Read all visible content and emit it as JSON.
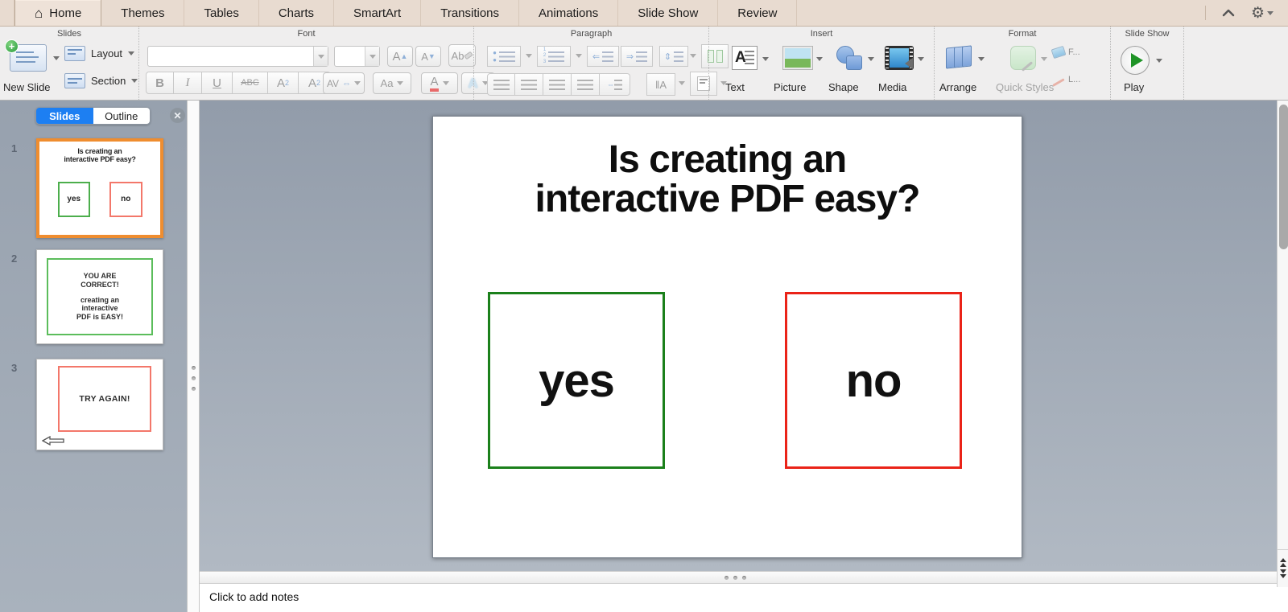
{
  "tabbar": {
    "tabs": [
      "Home",
      "Themes",
      "Tables",
      "Charts",
      "SmartArt",
      "Transitions",
      "Animations",
      "Slide Show",
      "Review"
    ],
    "active_tab": "Home"
  },
  "ribbon": {
    "slides": {
      "label": "Slides",
      "new_slide": "New Slide",
      "layout": "Layout",
      "section": "Section"
    },
    "font": {
      "label": "Font",
      "bold": "B",
      "italic": "I",
      "underline": "U",
      "strike": "ABC",
      "superscript_base": "A",
      "superscript_mark": "2",
      "subscript_base": "A",
      "subscript_mark": "2",
      "spacing": "AV",
      "change_case": "Aa",
      "font_color": "A",
      "text_effects": "A",
      "clear_formatting": "Ab"
    },
    "paragraph": {
      "label": "Paragraph"
    },
    "insert": {
      "label": "Insert",
      "text": "Text",
      "picture": "Picture",
      "shape": "Shape",
      "media": "Media"
    },
    "format": {
      "label": "Format",
      "arrange": "Arrange",
      "quick_styles": "Quick Styles",
      "fill": "F...",
      "line": "L..."
    },
    "slideshow": {
      "label": "Slide Show",
      "play": "Play"
    }
  },
  "sidebar": {
    "tabs": {
      "slides": "Slides",
      "outline": "Outline"
    },
    "thumbnails": [
      {
        "number": "1",
        "title_line1": "Is creating an",
        "title_line2": "interactive PDF easy?",
        "yes": "yes",
        "no": "no"
      },
      {
        "number": "2",
        "line1": "YOU ARE",
        "line2": "CORRECT!",
        "line3": "creating an",
        "line4": "interactive",
        "line5": "PDF is EASY!"
      },
      {
        "number": "3",
        "text": "TRY AGAIN!"
      }
    ]
  },
  "slide": {
    "title_line1": "Is creating an",
    "title_line2": "interactive PDF easy?",
    "yes": "yes",
    "no": "no"
  },
  "notes": {
    "placeholder": "Click to add notes"
  },
  "colors": {
    "selection_orange": "#ef8d2f",
    "yes_green": "#1b801b",
    "no_red": "#ea2318",
    "thumb_green": "#5bbd5b",
    "thumb_red": "#f3776a",
    "active_pane_tab_blue": "#1d7ff2",
    "tabbar_beige": "#e8dbd0",
    "canvas_gray_blue": "#9aa4b0"
  }
}
